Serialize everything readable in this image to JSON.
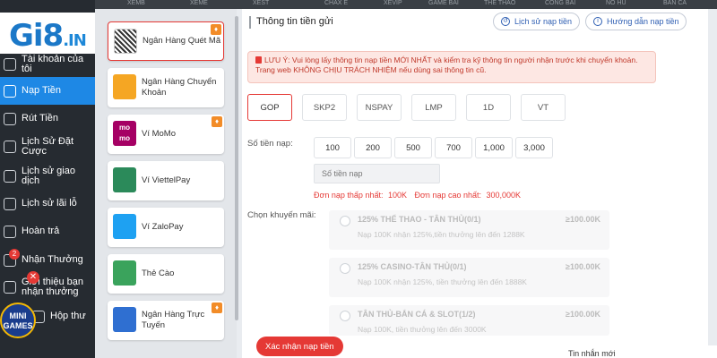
{
  "top_strip": {
    "items": [
      "XEMB",
      "XEME",
      "XEST",
      "CHAX E",
      "XEVIP",
      "GAME BÀI",
      "THỂ THAO",
      "CÔNG BÀI",
      "NỔ HŨ",
      "BẮN CÁ"
    ]
  },
  "brand": {
    "logo_main": "Gi8",
    "logo_suffix": ".IN"
  },
  "sidebar": {
    "items": [
      {
        "label": "Tài khoản của tôi",
        "icon": "user-icon"
      },
      {
        "label": "Nạp Tiền",
        "icon": "deposit-icon",
        "active": true
      },
      {
        "label": "Rút Tiền",
        "icon": "withdraw-icon"
      },
      {
        "label": "Lịch Sử Đặt Cược",
        "icon": "history-icon"
      },
      {
        "label": "Lịch sử giao dịch",
        "icon": "transaction-icon"
      },
      {
        "label": "Lịch sử lãi lỗ",
        "icon": "profit-icon"
      },
      {
        "label": "Hoàn trả",
        "icon": "refund-icon"
      },
      {
        "label": "Nhận Thưởng",
        "icon": "gift-icon"
      },
      {
        "label": "Giới thiệu bạn nhận thưởng",
        "icon": "referral-icon"
      },
      {
        "label": "Hộp thư",
        "icon": "mail-icon"
      }
    ],
    "notification_count": "2",
    "close_glyph": "✕",
    "minigames_label": "MINI GAMES"
  },
  "banks": [
    {
      "name": "Ngân Hàng Quét Mã",
      "icon": "qr-code-icon",
      "color": "#ffffff",
      "selected": true,
      "hot": true
    },
    {
      "name": "Ngân Hàng Chuyển Khoản",
      "icon": "bank-transfer-icon",
      "color": "#f5a623"
    },
    {
      "name": "Ví MoMo",
      "icon": "momo-icon",
      "color": "#a50064",
      "hot": true
    },
    {
      "name": "Ví ViettelPay",
      "icon": "viettelpay-icon",
      "color": "#2b8a5a"
    },
    {
      "name": "Ví ZaloPay",
      "icon": "zalopay-icon",
      "color": "#1ea1f2"
    },
    {
      "name": "Thẻ Cào",
      "icon": "scratch-card-icon",
      "color": "#3aa35c"
    },
    {
      "name": "Ngân Hàng Trực Tuyến",
      "icon": "online-bank-icon",
      "color": "#2f6fd1",
      "hot": true
    }
  ],
  "main": {
    "title": "Thông tin tiền gửi",
    "history_btn": "Lịch sử nạp tiền",
    "guide_btn": "Hướng dẫn nạp tiền",
    "notice": "LƯU Ý: Vui lòng lấy thông tin nạp tiền MỚI NHẤT và kiểm tra kỹ thông tin người nhận trước khi chuyển khoản. Trang web KHÔNG CHỊU TRÁCH NHIỆM nếu dùng sai thông tin cũ.",
    "channels": [
      "GOP",
      "SKP2",
      "NSPAY",
      "LMP",
      "1D",
      "VT"
    ],
    "active_channel": "GOP",
    "amount_label": "Số tiền nạp:",
    "amounts": [
      "100",
      "200",
      "500",
      "700",
      "1,000",
      "3,000"
    ],
    "amount_placeholder": "Số tiền nạp",
    "min_label": "Đơn nạp thấp nhất:",
    "min_value": "100K",
    "max_label": "Đơn nạp cao nhất:",
    "max_value": "300,000K",
    "promo_label": "Chọn khuyến mãi:",
    "promotions": [
      {
        "name": "125% THỂ THAO - TÂN THỦ(0/1)",
        "desc": "Nạp 100K nhận 125%,tiền thưởng lên đến 1288K",
        "min": "≥100.00K"
      },
      {
        "name": "125% CASINO-TÂN THỦ(0/1)",
        "desc": "Nạp 100K nhận 125%, tiền thưởng lên đến 1888K",
        "min": "≥100.00K"
      },
      {
        "name": "TÂN THỦ-BẮN CÁ & SLOT(1/2)",
        "desc": "Nạp 100K, tiền thưởng lên đến 3000K",
        "min": "≥100.00K"
      }
    ],
    "submit_label": "Xác nhận nạp tiền"
  },
  "footer_card": {
    "title": "Tin nhắn mới"
  },
  "colors": {
    "accent": "#1e88e5",
    "danger": "#e53935",
    "sidebar_bg": "#262b31"
  }
}
